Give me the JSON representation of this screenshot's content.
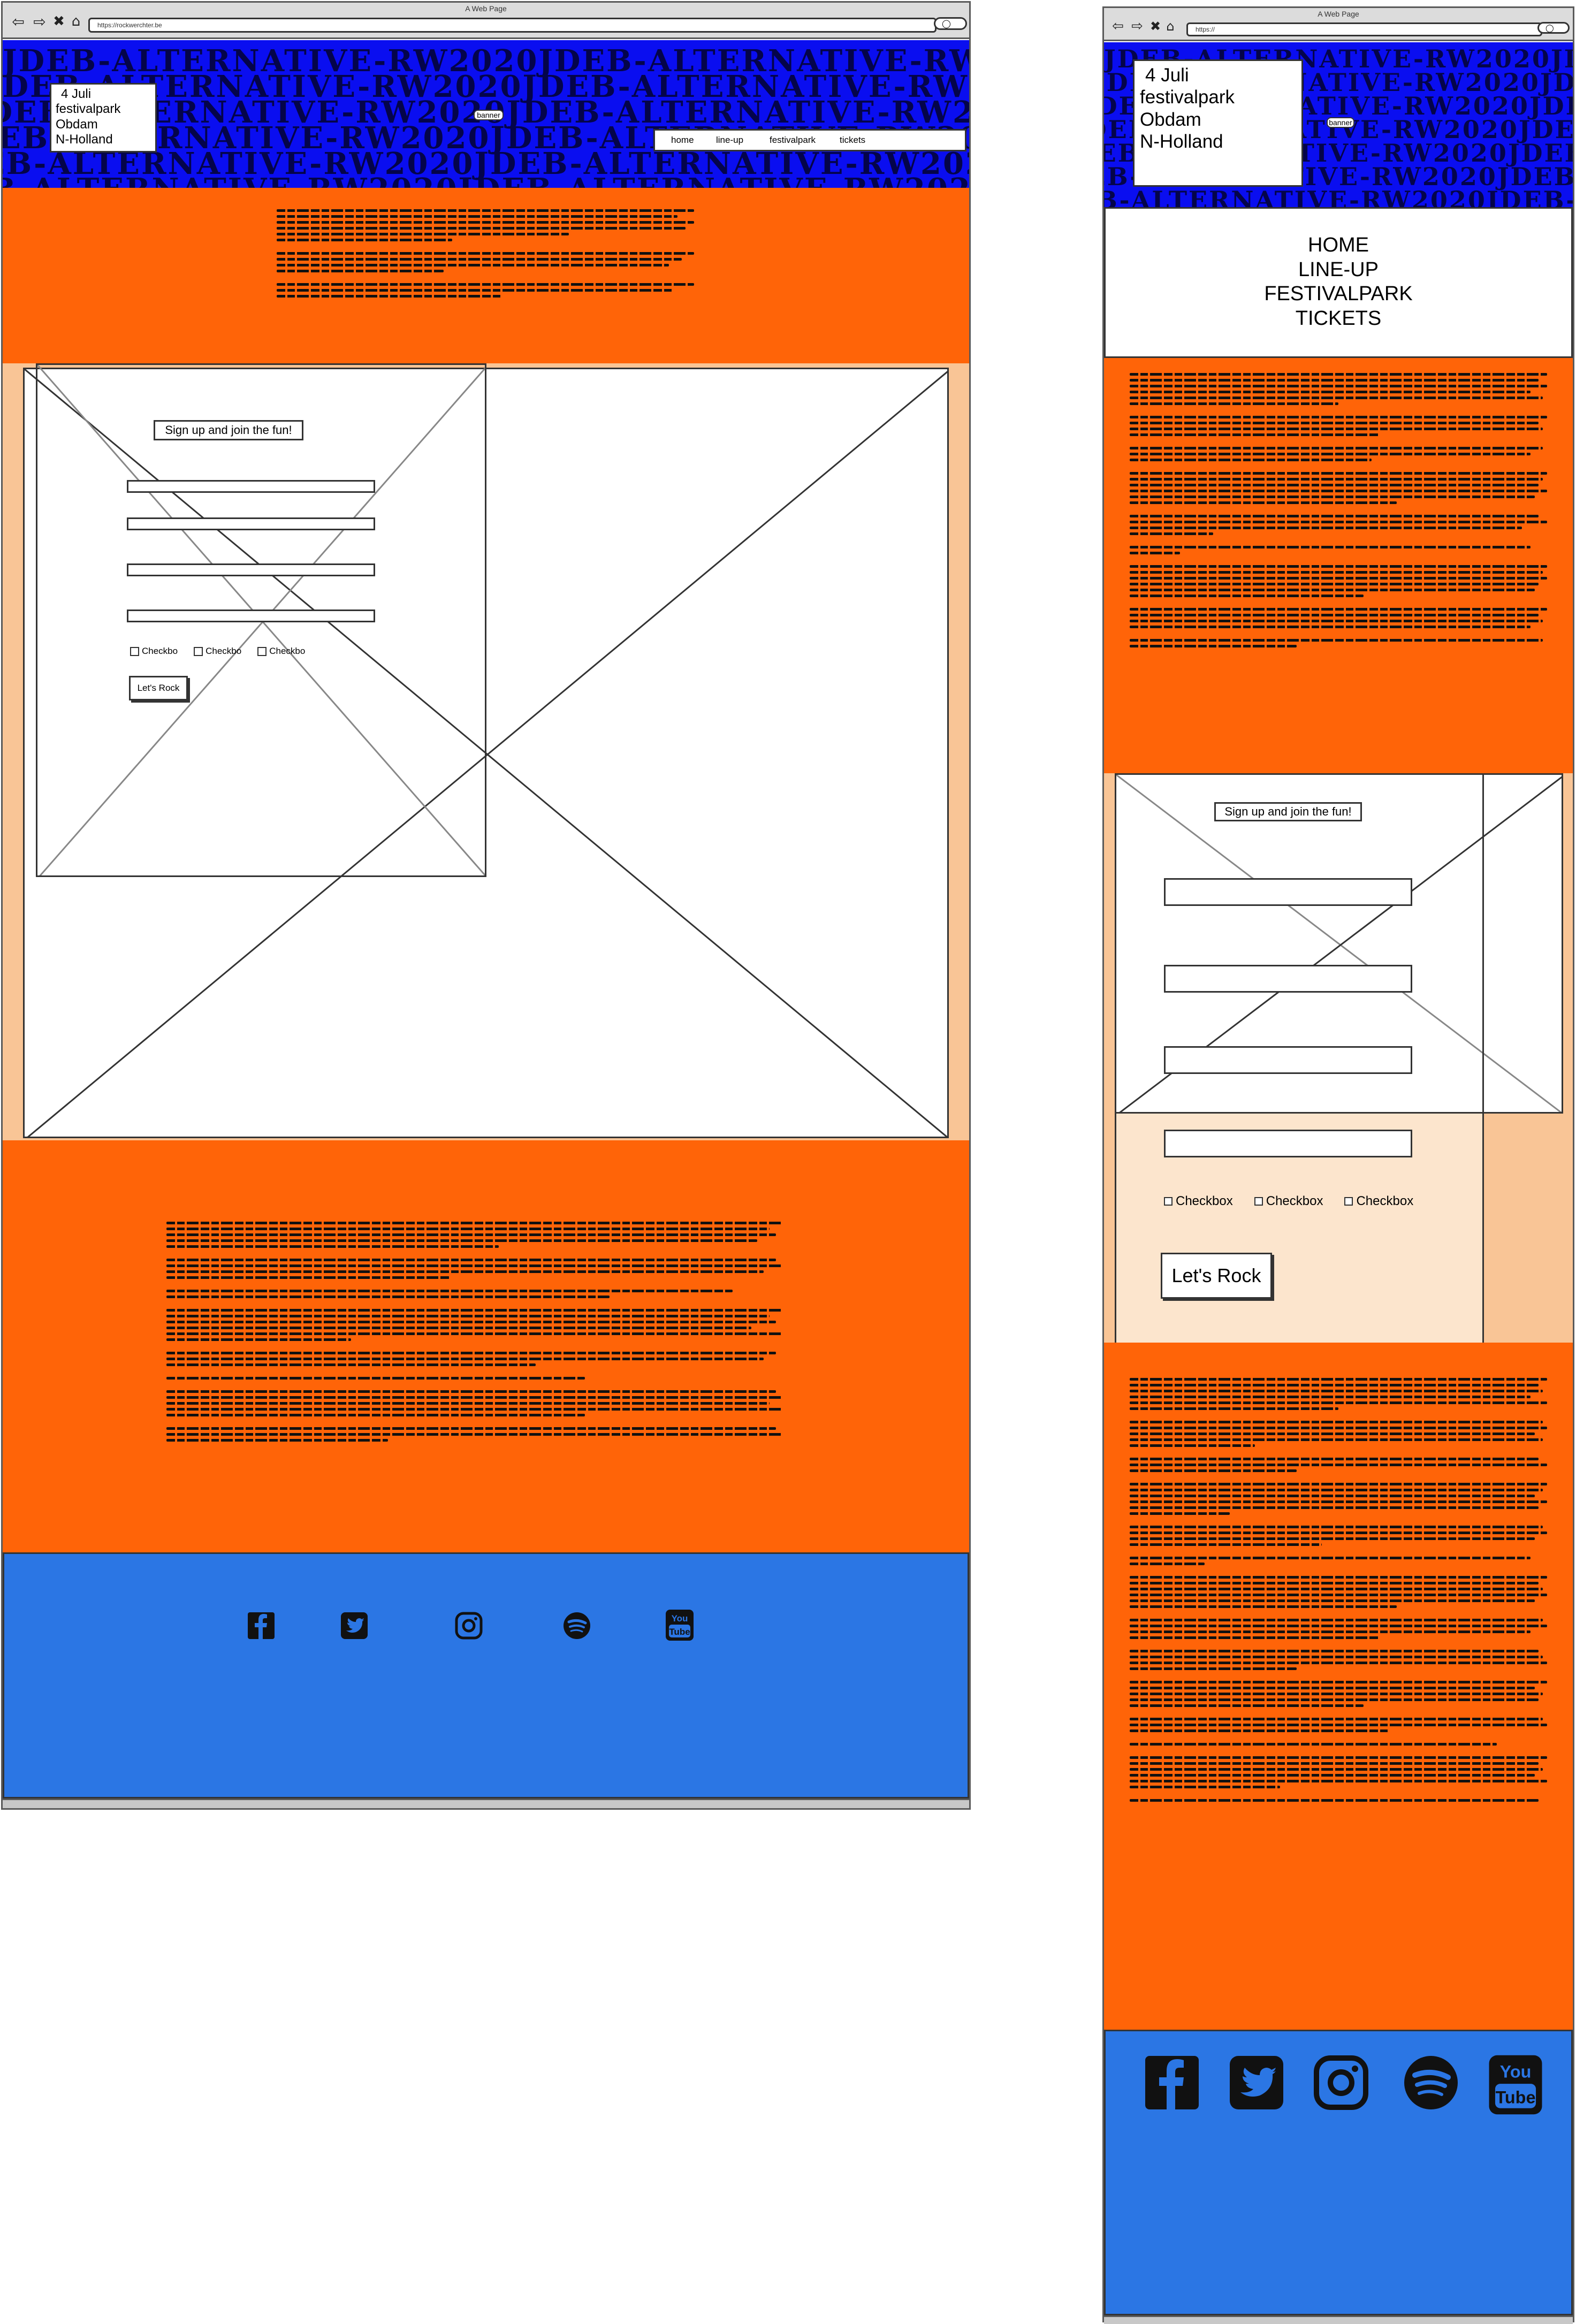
{
  "desktop": {
    "window_title": "A Web Page",
    "url": "https://rockwerchter.be",
    "banner_text": "JDEB-ALTERNATIVE-RW2020",
    "date_lines": [
      "4 Juli",
      "festivalpark",
      "Obdam",
      "N-Holland"
    ],
    "banner_button": "banner",
    "nav": [
      "home",
      "line-up",
      "festivalpark",
      "tickets"
    ],
    "signup_label": "Sign up and join the fun!",
    "checkboxes": [
      "Checkbo",
      "Checkbo",
      "Checkbo"
    ],
    "submit_label": "Let's Rock"
  },
  "mobile": {
    "window_title": "A Web Page",
    "url": "https://",
    "banner_text": "JDEB-ALTERNATIVE-RW2020",
    "date_lines": [
      "4 Juli",
      "festivalpark",
      "Obdam",
      "N-Holland"
    ],
    "banner_button": "banner",
    "nav": [
      "HOME",
      "LINE-UP",
      "FESTIVALPARK",
      "TICKETS"
    ],
    "signup_label": "Sign up and join the fun!",
    "checkboxes": [
      "Checkbox",
      "Checkbox",
      "Checkbox"
    ],
    "submit_label": "Let's Rock"
  },
  "social_icons": [
    "facebook-icon",
    "twitter-icon",
    "instagram-icon",
    "spotify-icon",
    "youtube-icon"
  ],
  "youtube_text": {
    "top": "You",
    "bottom": "Tube"
  },
  "colors": {
    "banner_blue": "#0a0ef0",
    "banner_text": "#04044a",
    "orange": "#ff6408",
    "peach": "#f9c596",
    "footer_blue": "#2b76e4"
  }
}
